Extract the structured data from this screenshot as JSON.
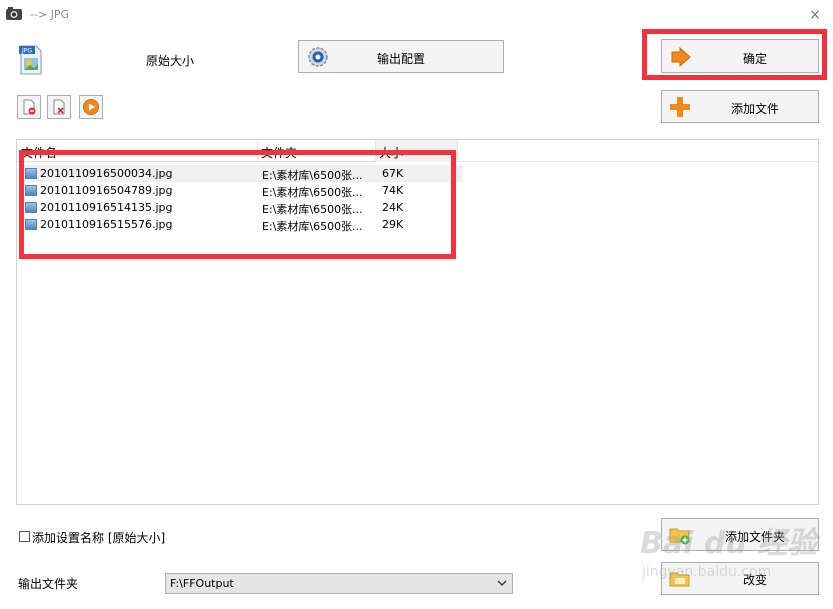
{
  "window": {
    "title": "--> JPG",
    "close_glyph": "×"
  },
  "preset": {
    "label": "原始大小",
    "format_badge": "JPG"
  },
  "buttons": {
    "output_config": "输出配置",
    "ok": "确定",
    "add_file": "添加文件",
    "add_folder": "添加文件夹",
    "change": "改变"
  },
  "toolbar": {
    "remove_icon": "remove-file-icon",
    "clear_icon": "clear-list-icon",
    "play_icon": "play-icon"
  },
  "file_list": {
    "columns": {
      "name": "文件名",
      "folder": "文件夹",
      "size": "大小"
    },
    "rows": [
      {
        "name": "2010110916500034.jpg",
        "folder": "E:\\素材库\\6500张...",
        "size": "67K"
      },
      {
        "name": "2010110916504789.jpg",
        "folder": "E:\\素材库\\6500张...",
        "size": "74K"
      },
      {
        "name": "2010110916514135.jpg",
        "folder": "E:\\素材库\\6500张...",
        "size": "24K"
      },
      {
        "name": "2010110916515576.jpg",
        "folder": "E:\\素材库\\6500张...",
        "size": "29K"
      }
    ]
  },
  "options": {
    "add_setting_name_label": "添加设置名称 [原始大小]",
    "add_setting_name_checked": false
  },
  "output_folder": {
    "label": "输出文件夹",
    "value": "F:\\FFOutput"
  },
  "watermark": {
    "line1": "Bai du 经验",
    "line2": "jingyan.baidu.com"
  },
  "colors": {
    "highlight": "#f2333d",
    "accent_orange": "#f08a1c"
  }
}
